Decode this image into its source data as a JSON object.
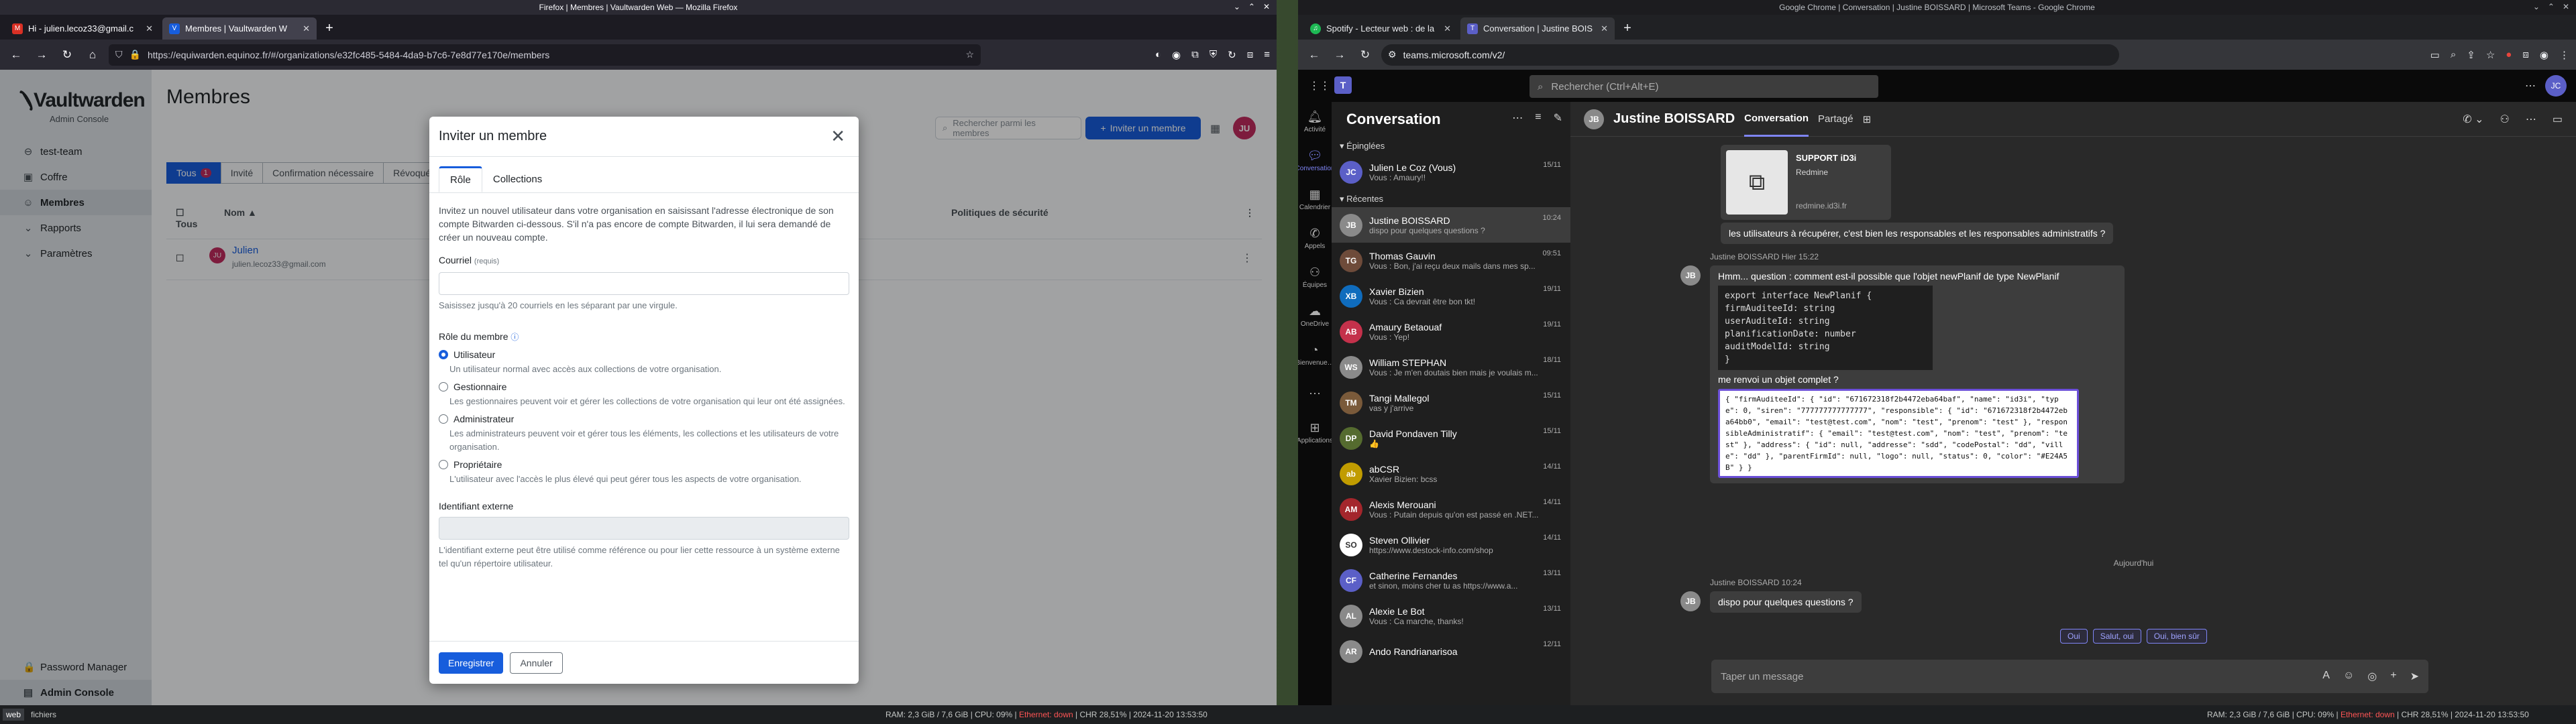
{
  "firefox": {
    "title": "Firefox | Membres | Vaultwarden Web — Mozilla Firefox",
    "tabs": [
      {
        "label": "Hi - julien.lecoz33@gmail.c",
        "icon": "gmail-icon"
      },
      {
        "label": "Membres | Vaultwarden W",
        "icon": "vaultwarden-icon"
      }
    ],
    "url": "https://equiwarden.equinoz.fr/#/organizations/e32fc485-5484-4da9-b7c6-7e8d77e170e/members"
  },
  "vaultwarden": {
    "logo": "Vaultwarden",
    "logo_sub": "Admin Console",
    "sidebar": [
      {
        "label": "test-team",
        "icon": "users-icon"
      },
      {
        "label": "Coffre",
        "icon": "vault-icon"
      },
      {
        "label": "Membres",
        "icon": "user-icon"
      },
      {
        "label": "Rapports",
        "icon": "report-icon"
      },
      {
        "label": "Paramètres",
        "icon": "gear-icon"
      }
    ],
    "sidebar_bottom": [
      {
        "label": "Password Manager"
      },
      {
        "label": "Admin Console"
      }
    ],
    "page_title": "Membres",
    "search_placeholder": "Rechercher parmi les membres",
    "invite_button": "Inviter un membre",
    "avatar": "JU",
    "filters": [
      {
        "label": "Tous",
        "badge": "1"
      },
      {
        "label": "Invité"
      },
      {
        "label": "Confirmation nécessaire"
      },
      {
        "label": "Révoqué"
      }
    ],
    "table_headers": {
      "all": "Tous",
      "name": "Nom",
      "policies": "Politiques de sécurité"
    },
    "member": {
      "name": "Julien",
      "email": "julien.lecoz33@gmail.com",
      "initials": "JU"
    }
  },
  "modal": {
    "title": "Inviter un membre",
    "tabs": [
      "Rôle",
      "Collections"
    ],
    "intro": "Invitez un nouvel utilisateur dans votre organisation en saisissant l'adresse électronique de son compte Bitwarden ci-dessous. S'il n'a pas encore de compte Bitwarden, il lui sera demandé de créer un nouveau compte.",
    "email_label": "Courriel",
    "email_required": "(requis)",
    "email_help": "Saisissez jusqu'à 20 courriels en les séparant par une virgule.",
    "role_label": "Rôle du membre",
    "roles": [
      {
        "title": "Utilisateur",
        "desc": "Un utilisateur normal avec accès aux collections de votre organisation."
      },
      {
        "title": "Gestionnaire",
        "desc": "Les gestionnaires peuvent voir et gérer les collections de votre organisation qui leur ont été assignées."
      },
      {
        "title": "Administrateur",
        "desc": "Les administrateurs peuvent voir et gérer tous les éléments, les collections et les utilisateurs de votre organisation."
      },
      {
        "title": "Propriétaire",
        "desc": "L'utilisateur avec l'accès le plus élevé qui peut gérer tous les aspects de votre organisation."
      }
    ],
    "selected_role": "Utilisateur",
    "external_label": "Identifiant externe",
    "external_help": "L'identifiant externe peut être utilisé comme référence ou pour lier cette ressource à un système externe tel qu'un répertoire utilisateur.",
    "save": "Enregistrer",
    "cancel": "Annuler"
  },
  "chrome": {
    "title": "Google Chrome | Conversation | Justine BOISSARD | Microsoft Teams - Google Chrome",
    "tabs": [
      {
        "label": "Spotify - Lecteur web : de la",
        "icon": "spotify-icon"
      },
      {
        "label": "Conversation | Justine BOIS",
        "icon": "teams-icon"
      }
    ],
    "url": "teams.microsoft.com/v2/"
  },
  "teams": {
    "search_placeholder": "Rechercher (Ctrl+Alt+E)",
    "rail": [
      {
        "label": "Activité",
        "icon": "bell-icon"
      },
      {
        "label": "Conversation",
        "icon": "chat-icon"
      },
      {
        "label": "Calendrier",
        "icon": "calendar-icon"
      },
      {
        "label": "Appels",
        "icon": "phone-icon"
      },
      {
        "label": "Équipes",
        "icon": "teams-icon"
      },
      {
        "label": "OneDrive",
        "icon": "cloud-icon"
      },
      {
        "label": "Bienvenue…",
        "icon": "welcome-icon"
      },
      {
        "label": "…",
        "icon": "more-icon"
      },
      {
        "label": "Applications",
        "icon": "apps-icon"
      }
    ],
    "list_title": "Conversation",
    "pinned_label": "Épinglées",
    "recent_label": "Récentes",
    "pinned": [
      {
        "name": "Julien Le Coz (Vous)",
        "preview": "Vous : Amaury!!",
        "time": "15/11",
        "initials": "JC",
        "color": "#5b5fc7"
      }
    ],
    "recent": [
      {
        "name": "Justine BOISSARD",
        "preview": "dispo pour quelques questions ?",
        "time": "10:24",
        "initials": "JB",
        "color": "#8a8a8a",
        "active": true
      },
      {
        "name": "Thomas Gauvin",
        "preview": "Vous : Bon, j'ai reçu deux mails dans mes sp...",
        "time": "09:51",
        "initials": "TG",
        "color": "#6e4b3a"
      },
      {
        "name": "Xavier Bizien",
        "preview": "Vous : Ca devrait être bon tkt!",
        "time": "19/11",
        "initials": "XB",
        "color": "#0f6cbd"
      },
      {
        "name": "Amaury Betaouaf",
        "preview": "Vous : Yep!",
        "time": "19/11",
        "initials": "AB",
        "color": "#c4314b"
      },
      {
        "name": "William STEPHAN",
        "preview": "Vous : Je m'en doutais bien mais je voulais m...",
        "time": "18/11",
        "initials": "WS",
        "color": "#8a8a8a"
      },
      {
        "name": "Tangi Mallegol",
        "preview": "vas y j'arrive",
        "time": "15/11",
        "initials": "TM",
        "color": "#7a5a3a"
      },
      {
        "name": "David Pondaven Tilly",
        "preview": "👍",
        "time": "15/11",
        "initials": "DP",
        "color": "#556b2f"
      },
      {
        "name": "abCSR",
        "preview": "Xavier Bizien: bcss",
        "time": "14/11",
        "initials": "ab",
        "color": "#c19c00"
      },
      {
        "name": "Alexis Merouani",
        "preview": "Vous : Putain depuis qu'on est passé en .NET...",
        "time": "14/11",
        "initials": "AM",
        "color": "#a4262c"
      },
      {
        "name": "Steven Ollivier",
        "preview": "https://www.destock-info.com/shop",
        "time": "14/11",
        "initials": "SO",
        "color": "#ffffff"
      },
      {
        "name": "Catherine Fernandes",
        "preview": "et sinon, moins cher tu as https://www.a...",
        "time": "13/11",
        "initials": "CF",
        "color": "#5b5fc7"
      },
      {
        "name": "Alexie Le Bot",
        "preview": "Vous : Ca marche, thanks!",
        "time": "13/11",
        "initials": "AL",
        "color": "#8a8a8a"
      },
      {
        "name": "Ando Randrianarisoa",
        "preview": "",
        "time": "12/11",
        "initials": "AR",
        "color": "#8a8a8a"
      }
    ],
    "conv_name": "Justine BOISSARD",
    "conv_initials": "JB",
    "conv_tabs": [
      "Conversation",
      "Partagé"
    ],
    "card": {
      "title": "SUPPORT iD3i",
      "subtitle": "Redmine",
      "link": "redmine.id3i.fr"
    },
    "msg_self_1": "les utilisateurs à récupérer, c'est bien les responsables et les responsables administratifs ?",
    "msg_meta_1": "Justine BOISSARD   Hier 15:22",
    "msg_2": "Hmm... question :  comment est-il possible que l'objet newPlanif de type NewPlanif",
    "code": [
      "export interface NewPlanif {",
      "  firmAuditeeId: string",
      "  userAuditeId: string",
      "  planificationDate: number",
      "  auditModelId: string",
      "}"
    ],
    "msg_3": "me renvoi un objet complet ?",
    "json_blob": "{ \"firmAuditeeId\": { \"id\": \"671672318f2b4472eba64baf\", \"name\": \"id3i\", \"type\": 0, \"siren\": \"777777777777777\", \"responsible\": { \"id\": \"671672318f2b4472eba64bb0\", \"email\": \"test@test.com\", \"nom\": \"test\", \"prenom\": \"test\" }, \"responsibleAdministratif\": { \"email\": \"test@test.com\", \"nom\": \"test\", \"prenom\": \"test\" }, \"address\": { \"id\": null, \"addresse\": \"sdd\", \"codePostal\": \"dd\", \"ville\": \"dd\" }, \"parentFirmId\": null, \"logo\": null, \"status\": 0, \"color\": \"#E24A5B\" } }",
    "day_sep": "Aujourd'hui",
    "msg_meta_2": "Justine BOISSARD   10:24",
    "msg_4": "dispo pour quelques questions ?",
    "suggestions": [
      "Oui",
      "Salut, oui",
      "Oui, bien sûr"
    ],
    "compose_placeholder": "Taper un message"
  },
  "taskbar": {
    "ws": "web",
    "ws2": "fichiers",
    "left_status": "RAM: 2,3 GiB / 7,6 GiB | CPU: 09% | Ethernet: down | CHR 28,51% | 2024-11-20 13:53:50",
    "right_status": "RAM: 2,3 GiB / 7,6 GiB | CPU: 09% | Ethernet: down | CHR 28,51% | 2024-11-20 13:53:50"
  }
}
